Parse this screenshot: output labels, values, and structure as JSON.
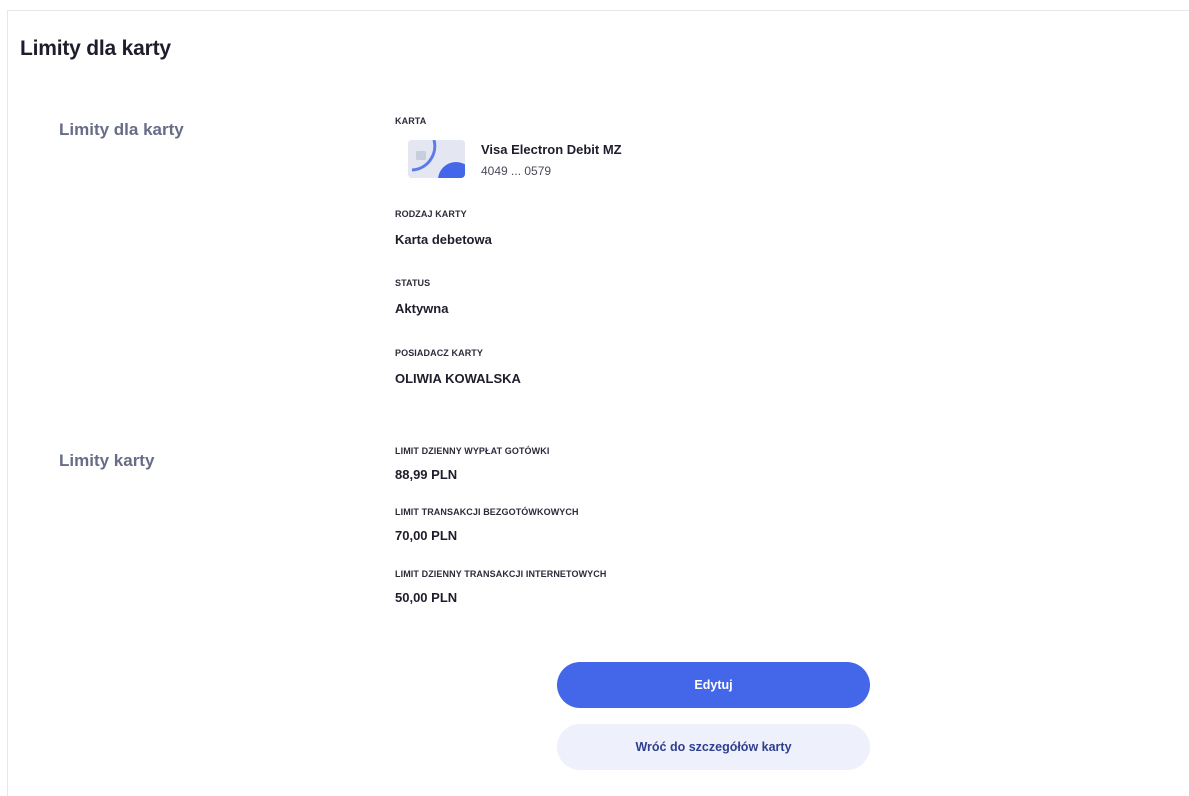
{
  "page": {
    "title": "Limity dla karty"
  },
  "card_section": {
    "title": "Limity dla karty",
    "card_label": "KARTA",
    "card_name": "Visa Electron Debit MZ",
    "card_number": "4049 ... 0579",
    "card_type_label": "RODZAJ KARTY",
    "card_type_value": "Karta debetowa",
    "status_label": "STATUS",
    "status_value": "Aktywna",
    "holder_label": "POSIADACZ KARTY",
    "holder_value": "OLIWIA KOWALSKA"
  },
  "limits_section": {
    "title": "Limity karty",
    "items": [
      {
        "label": "LIMIT DZIENNY WYPŁAT GOTÓWKI",
        "value": "88,99 PLN"
      },
      {
        "label": "LIMIT TRANSAKCJI BEZGOTÓWKOWYCH",
        "value": "70,00 PLN"
      },
      {
        "label": "LIMIT DZIENNY TRANSAKCJI INTERNETOWYCH",
        "value": "50,00 PLN"
      }
    ]
  },
  "actions": {
    "edit_label": "Edytuj",
    "back_label": "Wróć do szczegółów karty"
  },
  "colors": {
    "primary": "#4467ea",
    "secondary_bg": "#eef0fb",
    "section_title": "#676c87"
  }
}
